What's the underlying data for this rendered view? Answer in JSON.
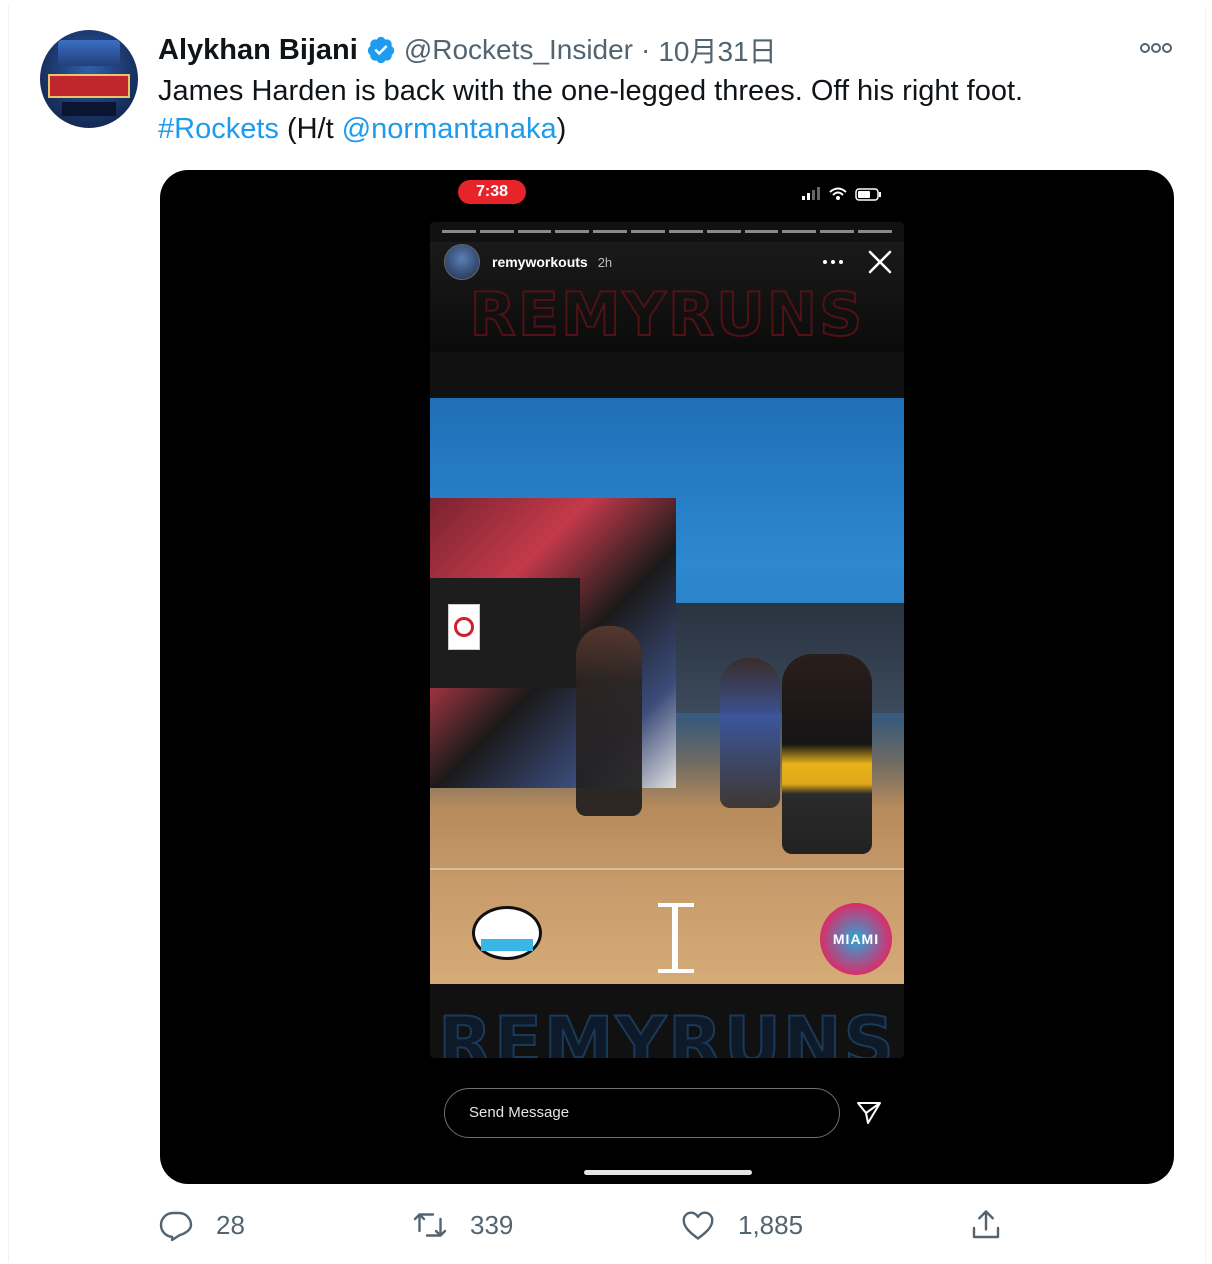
{
  "author": {
    "display_name": "Alykhan Bijani",
    "handle": "@Rockets_Insider",
    "separator": "·",
    "date": "10月31日"
  },
  "tweet": {
    "text_line1": "James Harden is back with the one-legged threes. Off his right foot.",
    "hashtag": "#Rockets",
    "ht_prefix": " (H/t ",
    "mention": "@normantanaka",
    "ht_suffix": ")"
  },
  "media": {
    "phone_time": "7:38",
    "story_username": "remyworkouts",
    "story_age": "2h",
    "banner_text": "REMYRUNS",
    "logo_right_text": "MIAMI",
    "message_placeholder": "Send Message"
  },
  "actions": {
    "replies": "28",
    "retweets": "339",
    "likes": "1,885"
  },
  "colors": {
    "link": "#1d9bf0",
    "verified": "#1d9bf0",
    "muted": "#536471",
    "recording_pill": "#e8242b"
  },
  "icons": [
    "verified-badge-icon",
    "more-icon",
    "reply-icon",
    "retweet-icon",
    "like-icon",
    "share-icon",
    "close-icon",
    "send-icon",
    "wifi-icon",
    "battery-icon",
    "signal-icon"
  ]
}
